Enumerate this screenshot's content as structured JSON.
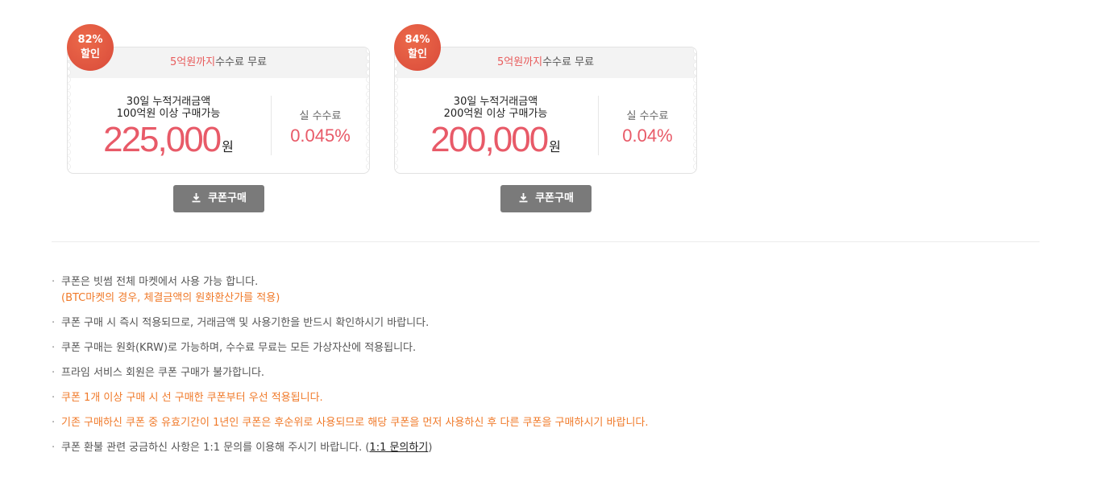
{
  "coupons": [
    {
      "badge_pct": "82%",
      "badge_label": "할인",
      "head_red": "5억원까지",
      "head_text": "수수료 무료",
      "cond_line1": "30일 누적거래금액",
      "cond_line2": "100억원 이상 구매가능",
      "price": "225,000",
      "unit": "원",
      "fee_label": "실 수수료",
      "fee_value": "0.045%",
      "button_label": "쿠폰구매"
    },
    {
      "badge_pct": "84%",
      "badge_label": "할인",
      "head_red": "5억원까지",
      "head_text": "수수료 무료",
      "cond_line1": "30일 누적거래금액",
      "cond_line2": "200억원 이상 구매가능",
      "price": "200,000",
      "unit": "원",
      "fee_label": "실 수수료",
      "fee_value": "0.04%",
      "button_label": "쿠폰구매"
    }
  ],
  "notes": {
    "bullet": "·",
    "n1": "쿠폰은 빗썸 전체 마켓에서 사용 가능 합니다.",
    "n1_sub": "(BTC마켓의 경우, 체결금액의 원화환산가를 적용)",
    "n2": "쿠폰 구매 시 즉시 적용되므로, 거래금액 및 사용기한을 반드시 확인하시기 바랍니다.",
    "n3": "쿠폰 구매는 원화(KRW)로 가능하며, 수수료 무료는 모든 가상자산에 적용됩니다.",
    "n4": "프라임 서비스 회원은 쿠폰 구매가 불가합니다.",
    "n5": "쿠폰 1개 이상 구매 시 선 구매한 쿠폰부터 우선 적용됩니다.",
    "n6": "기존 구매하신 쿠폰 중 유효기간이 1년인 쿠폰은 후순위로 사용되므로 해당 쿠폰을 먼저 사용하신 후 다른 쿠폰을 구매하시기 바랍니다.",
    "n7": "쿠폰 환불 관련 궁금하신 사항은 1:1 문의를 이용해 주시기 바랍니다. (",
    "n7_link": "1:1 문의하기",
    "n7_end": ")"
  },
  "colors": {
    "accent": "#e85a68",
    "orange": "#f07a2a",
    "button": "#7a7a7a",
    "badge": "#de5038"
  },
  "icons": {
    "button_icon": "download-icon"
  }
}
